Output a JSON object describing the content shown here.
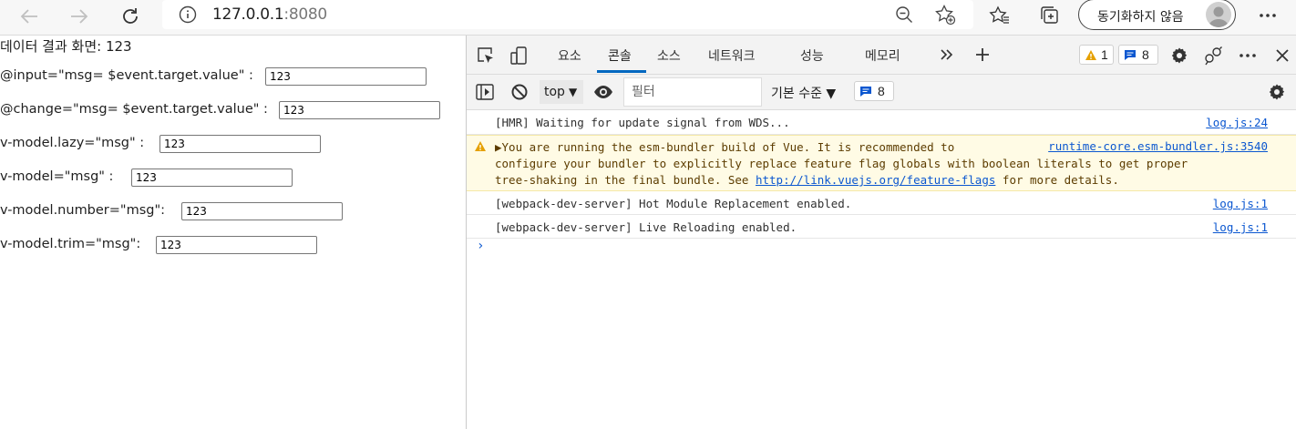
{
  "browser": {
    "address_host": "127.0.0.1",
    "address_port": ":8080",
    "sync_label": "동기화하지 않음"
  },
  "page": {
    "title": "데이터 결과 화면: 123",
    "rows": [
      {
        "label": "@input=\"msg= $event.target.value\" :",
        "value": "123"
      },
      {
        "label": "@change=\"msg= $event.target.value\" :",
        "value": "123"
      },
      {
        "label": "v-model.lazy=\"msg\" :",
        "value": "123"
      },
      {
        "label": "v-model=\"msg\" :",
        "value": "123"
      },
      {
        "label": "v-model.number=\"msg\":",
        "value": "123"
      },
      {
        "label": "v-model.trim=\"msg\":",
        "value": "123"
      }
    ]
  },
  "devtools": {
    "tabs": [
      "요소",
      "콘솔",
      "소스",
      "네트워크",
      "성능",
      "메모리"
    ],
    "active_tab": "콘솔",
    "warning_count": "1",
    "message_count": "8",
    "context": "top",
    "filter_placeholder": "필터",
    "level_label": "기본 수준 ▼",
    "toolbar_message_count": "8",
    "messages": [
      {
        "text": "[HMR] Waiting for update signal from WDS...",
        "source": "log.js:24"
      },
      {
        "text": "[webpack-dev-server] Hot Module Replacement enabled.",
        "source": "log.js:1"
      },
      {
        "text": "[webpack-dev-server] Live Reloading enabled.",
        "source": "log.js:1"
      }
    ],
    "warning": {
      "line1": "▶You are running the esm-bundler build of Vue. It is recommended to",
      "line2": "configure your bundler to explicitly replace feature flag globals with boolean literals to get proper",
      "line3_prefix": "tree-shaking in the final bundle. See ",
      "line3_link": "http://link.vuejs.org/feature-flags",
      "line3_suffix": " for more details.",
      "source": "runtime-core.esm-bundler.js:3540"
    },
    "prompt": "›"
  },
  "colors": {
    "accent": "#0067c0",
    "link": "#0b57d0",
    "warn_bg": "#fffbe5",
    "warn_icon": "#e5a000"
  }
}
